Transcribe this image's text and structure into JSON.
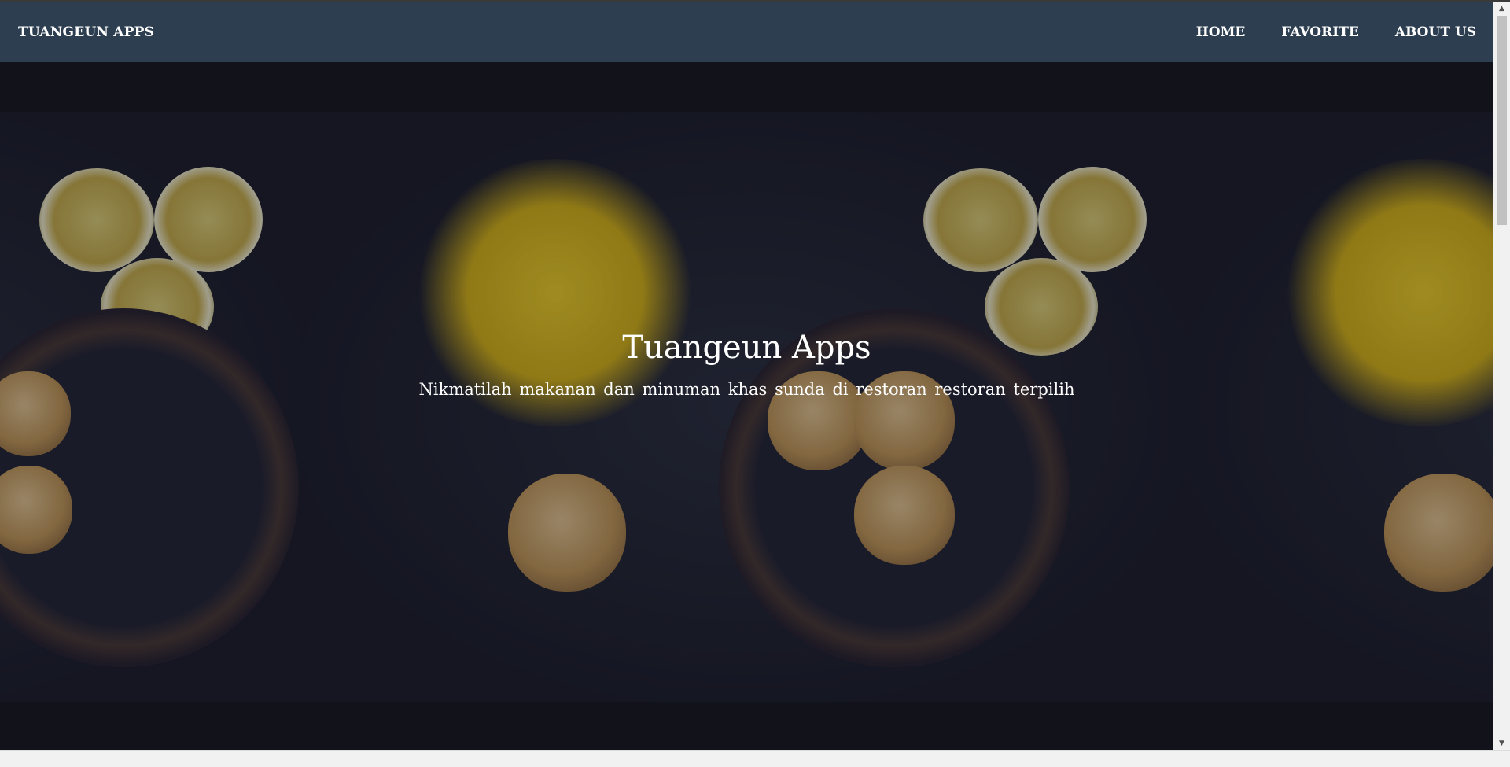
{
  "navbar": {
    "brand": "TUANGEUN APPS",
    "links": [
      {
        "label": "HOME"
      },
      {
        "label": "FAVORITE"
      },
      {
        "label": "ABOUT US"
      }
    ],
    "background_color": "#2c3e50"
  },
  "hero": {
    "title": "Tuangeun Apps",
    "subtitle": "Nikmatilah makanan dan minuman khas sunda di restoran restoran terpilih"
  },
  "icons": {
    "scroll_up": "scroll-up-arrow-icon",
    "scroll_down": "scroll-down-arrow-icon"
  }
}
